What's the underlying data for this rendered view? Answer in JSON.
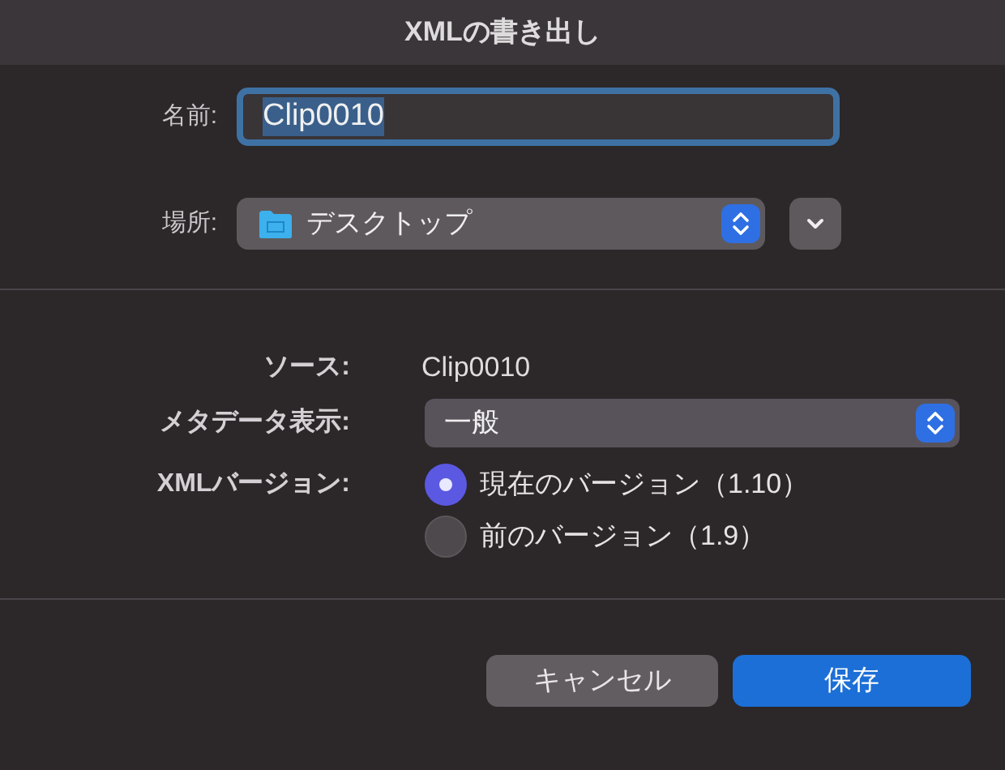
{
  "window": {
    "title": "XMLの書き出し"
  },
  "name_field": {
    "label": "名前:",
    "value": "Clip0010",
    "focused": true
  },
  "location": {
    "label": "場所:",
    "value": "デスクトップ"
  },
  "source": {
    "label": "ソース:",
    "value": "Clip0010"
  },
  "metadata_view": {
    "label": "メタデータ表示:",
    "value": "一般"
  },
  "xml_version": {
    "label": "XMLバージョン:",
    "options": [
      {
        "label": "現在のバージョン（1.10）",
        "selected": true
      },
      {
        "label": "前のバージョン（1.9）",
        "selected": false
      }
    ]
  },
  "buttons": [
    {
      "label": "キャンセル",
      "kind": "secondary"
    },
    {
      "label": "保存",
      "kind": "primary"
    }
  ]
}
